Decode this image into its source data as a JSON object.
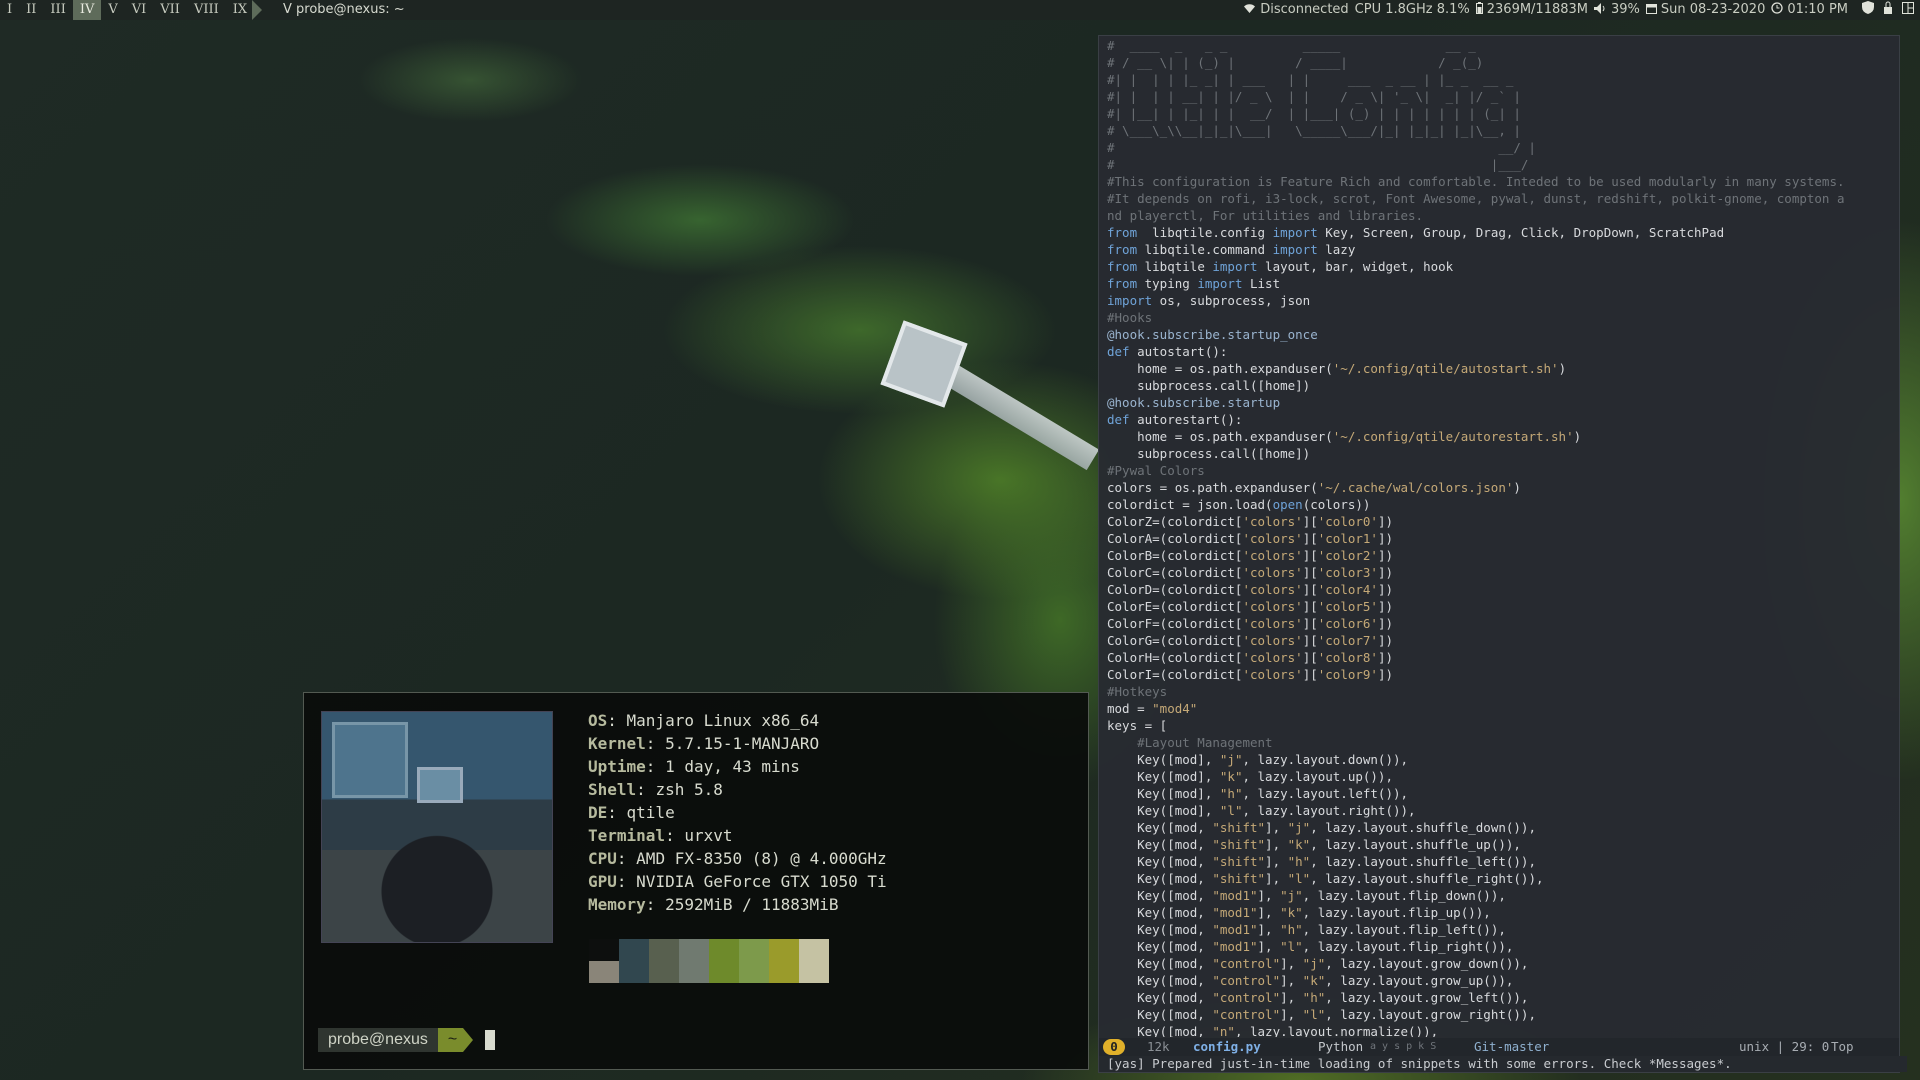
{
  "topbar": {
    "groups": [
      "I",
      "II",
      "III",
      "IV",
      "V",
      "VI",
      "VII",
      "VIII",
      "IX"
    ],
    "active_group": "IV",
    "window_title": "V probe@nexus: ~",
    "network": "Disconnected",
    "cpu": "CPU 1.8GHz 8.1%",
    "memory": "2369M/11883M",
    "volume": "39%",
    "date": "Sun 08-23-2020",
    "time": "01:10 PM",
    "icons": [
      "wifi-icon",
      "battery-icon",
      "volume-icon",
      "calendar-icon",
      "clock-icon",
      "shield-icon",
      "lock-icon",
      "layout-icon"
    ]
  },
  "terminal": {
    "info": [
      {
        "key": "OS",
        "value": "Manjaro Linux x86_64"
      },
      {
        "key": "Kernel",
        "value": "5.7.15-1-MANJARO"
      },
      {
        "key": "Uptime",
        "value": "1 day, 43 mins"
      },
      {
        "key": "Shell",
        "value": "zsh 5.8"
      },
      {
        "key": "DE",
        "value": "qtile"
      },
      {
        "key": "Terminal",
        "value": "urxvt"
      },
      {
        "key": "CPU",
        "value": "AMD FX-8350 (8) @ 4.000GHz"
      },
      {
        "key": "GPU",
        "value": "NVIDIA GeForce GTX 1050 Ti"
      },
      {
        "key": "Memory",
        "value": "2592MiB / 11883MiB"
      }
    ],
    "palette_top": [
      "#0d0f0e",
      "#31474f",
      "#58604f",
      "#707a70",
      "#6e8a2b",
      "#7d9a4b",
      "#9a9b2b",
      "#c5c2a3"
    ],
    "palette_bottom": [
      "#8a8579",
      "#31474f",
      "#58604f",
      "#707a70",
      "#6e8a2b",
      "#7d9a4b",
      "#9a9b2b",
      "#c5c2a3"
    ],
    "prompt_user": "probe@nexus",
    "prompt_dir": "~"
  },
  "editor": {
    "lines": [
      [
        [
          "cm",
          "#  ____  _   _ _          _____              __ _"
        ]
      ],
      [
        [
          "cm",
          "# / __ \\| | (_) |        / ____|            / _(_)"
        ]
      ],
      [
        [
          "cm",
          "#| |  | | |_ _| | ___   | |     ___  _ __ | |_ _  __ _"
        ]
      ],
      [
        [
          "cm",
          "#| |  | | __| | |/ _ \\  | |    / _ \\| '_ \\|  _| |/ _` |"
        ]
      ],
      [
        [
          "cm",
          "#| |__| | |_| | |  __/  | |___| (_) | | | | | | | (_| |"
        ]
      ],
      [
        [
          "cm",
          "# \\___\\_\\\\__|_|_|\\___|   \\_____\\___/|_| |_|_| |_|\\__, |"
        ]
      ],
      [
        [
          "cm",
          "#                                                   __/ |"
        ]
      ],
      [
        [
          "cm",
          "#                                                  |___/"
        ]
      ],
      [
        [
          "cm",
          "#This configuration is Feature Rich and comfortable. Inteded to be used modularly in many systems."
        ]
      ],
      [
        [
          "cm",
          "#It depends on rofi, i3-lock, scrot, Font Awesome, pywal, dunst, redshift, polkit-gnome, compton a"
        ]
      ],
      [
        [
          "cm",
          "nd playerctl, For utilities and libraries."
        ]
      ],
      [
        [
          "kw",
          "from"
        ],
        [
          "",
          "  libqtile.config "
        ],
        [
          "kw",
          "import"
        ],
        [
          "",
          " Key, Screen, Group, Drag, Click, DropDown, ScratchPad"
        ]
      ],
      [
        [
          "kw",
          "from"
        ],
        [
          "",
          " libqtile.command "
        ],
        [
          "kw",
          "import"
        ],
        [
          "",
          " lazy"
        ]
      ],
      [
        [
          "kw",
          "from"
        ],
        [
          "",
          " libqtile "
        ],
        [
          "kw",
          "import"
        ],
        [
          "",
          " layout, bar, widget, hook"
        ]
      ],
      [
        [
          "kw",
          "from"
        ],
        [
          "",
          " typing "
        ],
        [
          "kw",
          "import"
        ],
        [
          "",
          " List"
        ]
      ],
      [
        [
          "kw",
          "import"
        ],
        [
          "",
          " os, subprocess, json"
        ]
      ],
      [
        [
          "cm",
          "#Hooks"
        ]
      ],
      [
        [
          "deco",
          "@hook.subscribe.startup_once"
        ]
      ],
      [
        [
          "kw",
          "def"
        ],
        [
          "",
          " autostart():"
        ]
      ],
      [
        [
          "",
          "    home = os.path.expanduser("
        ],
        [
          "st2",
          "'~/.config/qtile/autostart.sh'"
        ],
        [
          "",
          ")"
        ]
      ],
      [
        [
          "",
          "    subprocess.call([home])"
        ]
      ],
      [
        [
          "deco",
          "@hook.subscribe.startup"
        ]
      ],
      [
        [
          "kw",
          "def"
        ],
        [
          "",
          " autorestart():"
        ]
      ],
      [
        [
          "",
          "    home = os.path.expanduser("
        ],
        [
          "st2",
          "'~/.config/qtile/autorestart.sh'"
        ],
        [
          "",
          ")"
        ]
      ],
      [
        [
          "",
          "    subprocess.call([home])"
        ]
      ],
      [
        [
          "cm",
          "#Pywal Colors"
        ]
      ],
      [
        [
          "",
          "colors = os.path.expanduser("
        ],
        [
          "st2",
          "'~/.cache/wal/colors.json'"
        ],
        [
          "",
          ")"
        ]
      ],
      [
        [
          "",
          "colordict = json.load("
        ],
        [
          "kw",
          "open"
        ],
        [
          "",
          "(colors))"
        ]
      ],
      [
        [
          "",
          "ColorZ=(colordict["
        ],
        [
          "st2",
          "'colors'"
        ],
        [
          "",
          "]["
        ],
        [
          "st2",
          "'color0'"
        ],
        [
          "",
          "])"
        ]
      ],
      [
        [
          "",
          "ColorA=(colordict["
        ],
        [
          "st2",
          "'colors'"
        ],
        [
          "",
          "]["
        ],
        [
          "st2",
          "'color1'"
        ],
        [
          "",
          "])"
        ]
      ],
      [
        [
          "",
          "ColorB=(colordict["
        ],
        [
          "st2",
          "'colors'"
        ],
        [
          "",
          "]["
        ],
        [
          "st2",
          "'color2'"
        ],
        [
          "",
          "])"
        ]
      ],
      [
        [
          "",
          "ColorC=(colordict["
        ],
        [
          "st2",
          "'colors'"
        ],
        [
          "",
          "]["
        ],
        [
          "st2",
          "'color3'"
        ],
        [
          "",
          "])"
        ]
      ],
      [
        [
          "",
          "ColorD=(colordict["
        ],
        [
          "st2",
          "'colors'"
        ],
        [
          "",
          "]["
        ],
        [
          "st2",
          "'color4'"
        ],
        [
          "",
          "])"
        ]
      ],
      [
        [
          "",
          "ColorE=(colordict["
        ],
        [
          "st2",
          "'colors'"
        ],
        [
          "",
          "]["
        ],
        [
          "st2",
          "'color5'"
        ],
        [
          "",
          "])"
        ]
      ],
      [
        [
          "",
          "ColorF=(colordict["
        ],
        [
          "st2",
          "'colors'"
        ],
        [
          "",
          "]["
        ],
        [
          "st2",
          "'color6'"
        ],
        [
          "",
          "])"
        ]
      ],
      [
        [
          "",
          "ColorG=(colordict["
        ],
        [
          "st2",
          "'colors'"
        ],
        [
          "",
          "]["
        ],
        [
          "st2",
          "'color7'"
        ],
        [
          "",
          "])"
        ]
      ],
      [
        [
          "",
          "ColorH=(colordict["
        ],
        [
          "st2",
          "'colors'"
        ],
        [
          "",
          "]["
        ],
        [
          "st2",
          "'color8'"
        ],
        [
          "",
          "])"
        ]
      ],
      [
        [
          "",
          "ColorI=(colordict["
        ],
        [
          "st2",
          "'colors'"
        ],
        [
          "",
          "]["
        ],
        [
          "st2",
          "'color9'"
        ],
        [
          "",
          "])"
        ]
      ],
      [
        [
          "cm",
          "#Hotkeys"
        ]
      ],
      [
        [
          "",
          "mod = "
        ],
        [
          "st2",
          "\"mod4\""
        ]
      ],
      [
        [
          "",
          "keys = ["
        ]
      ],
      [
        [
          "cm",
          "    #Layout Management"
        ]
      ],
      [
        [
          "",
          "    Key([mod], "
        ],
        [
          "st2",
          "\"j\""
        ],
        [
          "",
          ", lazy.layout.down()),"
        ]
      ],
      [
        [
          "",
          "    Key([mod], "
        ],
        [
          "st2",
          "\"k\""
        ],
        [
          "",
          ", lazy.layout.up()),"
        ]
      ],
      [
        [
          "",
          "    Key([mod], "
        ],
        [
          "st2",
          "\"h\""
        ],
        [
          "",
          ", lazy.layout.left()),"
        ]
      ],
      [
        [
          "",
          "    Key([mod], "
        ],
        [
          "st2",
          "\"l\""
        ],
        [
          "",
          ", lazy.layout.right()),"
        ]
      ],
      [
        [
          "",
          "    Key([mod, "
        ],
        [
          "st2",
          "\"shift\""
        ],
        [
          "",
          "], "
        ],
        [
          "st2",
          "\"j\""
        ],
        [
          "",
          ", lazy.layout.shuffle_down()),"
        ]
      ],
      [
        [
          "",
          "    Key([mod, "
        ],
        [
          "st2",
          "\"shift\""
        ],
        [
          "",
          "], "
        ],
        [
          "st2",
          "\"k\""
        ],
        [
          "",
          ", lazy.layout.shuffle_up()),"
        ]
      ],
      [
        [
          "",
          "    Key([mod, "
        ],
        [
          "st2",
          "\"shift\""
        ],
        [
          "",
          "], "
        ],
        [
          "st2",
          "\"h\""
        ],
        [
          "",
          ", lazy.layout.shuffle_left()),"
        ]
      ],
      [
        [
          "",
          "    Key([mod, "
        ],
        [
          "st2",
          "\"shift\""
        ],
        [
          "",
          "], "
        ],
        [
          "st2",
          "\"l\""
        ],
        [
          "",
          ", lazy.layout.shuffle_right()),"
        ]
      ],
      [
        [
          "",
          "    Key([mod, "
        ],
        [
          "st2",
          "\"mod1\""
        ],
        [
          "",
          "], "
        ],
        [
          "st2",
          "\"j\""
        ],
        [
          "",
          ", lazy.layout.flip_down()),"
        ]
      ],
      [
        [
          "",
          "    Key([mod, "
        ],
        [
          "st2",
          "\"mod1\""
        ],
        [
          "",
          "], "
        ],
        [
          "st2",
          "\"k\""
        ],
        [
          "",
          ", lazy.layout.flip_up()),"
        ]
      ],
      [
        [
          "",
          "    Key([mod, "
        ],
        [
          "st2",
          "\"mod1\""
        ],
        [
          "",
          "], "
        ],
        [
          "st2",
          "\"h\""
        ],
        [
          "",
          ", lazy.layout.flip_left()),"
        ]
      ],
      [
        [
          "",
          "    Key([mod, "
        ],
        [
          "st2",
          "\"mod1\""
        ],
        [
          "",
          "], "
        ],
        [
          "st2",
          "\"l\""
        ],
        [
          "",
          ", lazy.layout.flip_right()),"
        ]
      ],
      [
        [
          "",
          "    Key([mod, "
        ],
        [
          "st2",
          "\"control\""
        ],
        [
          "",
          "], "
        ],
        [
          "st2",
          "\"j\""
        ],
        [
          "",
          ", lazy.layout.grow_down()),"
        ]
      ],
      [
        [
          "",
          "    Key([mod, "
        ],
        [
          "st2",
          "\"control\""
        ],
        [
          "",
          "], "
        ],
        [
          "st2",
          "\"k\""
        ],
        [
          "",
          ", lazy.layout.grow_up()),"
        ]
      ],
      [
        [
          "",
          "    Key([mod, "
        ],
        [
          "st2",
          "\"control\""
        ],
        [
          "",
          "], "
        ],
        [
          "st2",
          "\"h\""
        ],
        [
          "",
          ", lazy.layout.grow_left()),"
        ]
      ],
      [
        [
          "",
          "    Key([mod, "
        ],
        [
          "st2",
          "\"control\""
        ],
        [
          "",
          "], "
        ],
        [
          "st2",
          "\"l\""
        ],
        [
          "",
          ", lazy.layout.grow_right()),"
        ]
      ],
      [
        [
          "",
          "    Key([mod, "
        ],
        [
          "st2",
          "\"n\""
        ],
        [
          "",
          ", lazy.layout.normalize()),"
        ]
      ]
    ],
    "modeline": {
      "state": "0",
      "size": "12k",
      "file": "config.py",
      "mode": "Python",
      "minor_modes": "a y s p k S",
      "branch": "Git-master",
      "encoding": "unix | 29: 0",
      "position": "Top"
    },
    "echo": "[yas] Prepared just-in-time loading of snippets with some errors.  Check *Messages*."
  }
}
